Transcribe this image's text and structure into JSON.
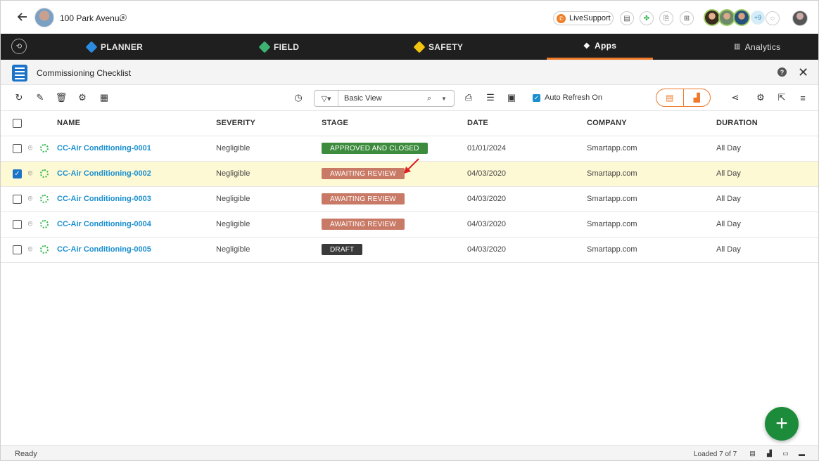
{
  "topbar": {
    "project_name": "100 Park Avenue",
    "live_support_label": "LiveSupport",
    "extra_people_count": "+9",
    "icons": [
      "back-arrow-icon",
      "settings-icon",
      "live-support-icon",
      "notes-icon",
      "apps-icon",
      "document-settings-icon",
      "forms-icon",
      "chat-icon",
      "user-avatar"
    ]
  },
  "modules": {
    "planner": "PLANNER",
    "field": "FIELD",
    "safety": "SAFETY",
    "apps": "Apps",
    "analytics": "Analytics",
    "active": "Apps",
    "colors": {
      "planner": "#2b8be0",
      "field": "#3cb371",
      "safety": "#f2c40f",
      "accent": "#ef7a2a"
    }
  },
  "panel": {
    "title": "Commissioning Checklist",
    "help": "?"
  },
  "toolbar": {
    "view_value": "Basic View",
    "auto_refresh_label": "Auto Refresh On",
    "auto_refresh_checked": true
  },
  "table": {
    "columns": {
      "name": "NAME",
      "severity": "SEVERITY",
      "stage": "STAGE",
      "date": "DATE",
      "company": "COMPANY",
      "duration": "DURATION"
    },
    "rows": [
      {
        "name": "CC-Air Conditioning-0001",
        "severity": "Negligible",
        "stage": "APPROVED AND CLOSED",
        "stage_color": "#3d8b3d",
        "date": "01/01/2024",
        "company": "Smartapp.com",
        "duration": "All Day",
        "selected": false
      },
      {
        "name": "CC-Air Conditioning-0002",
        "severity": "Negligible",
        "stage": "AWAITING REVIEW",
        "stage_color": "#c97a66",
        "date": "04/03/2020",
        "company": "Smartapp.com",
        "duration": "All Day",
        "selected": true
      },
      {
        "name": "CC-Air Conditioning-0003",
        "severity": "Negligible",
        "stage": "AWAITING REVIEW",
        "stage_color": "#c97a66",
        "date": "04/03/2020",
        "company": "Smartapp.com",
        "duration": "All Day",
        "selected": false
      },
      {
        "name": "CC-Air Conditioning-0004",
        "severity": "Negligible",
        "stage": "AWAITING REVIEW",
        "stage_color": "#c97a66",
        "date": "04/03/2020",
        "company": "Smartapp.com",
        "duration": "All Day",
        "selected": false
      },
      {
        "name": "CC-Air Conditioning-0005",
        "severity": "Negligible",
        "stage": "DRAFT",
        "stage_color": "#3a3a3a",
        "date": "04/03/2020",
        "company": "Smartapp.com",
        "duration": "All Day",
        "selected": false
      }
    ]
  },
  "status": {
    "text": "Ready",
    "loaded": "Loaded 7 of 7"
  }
}
